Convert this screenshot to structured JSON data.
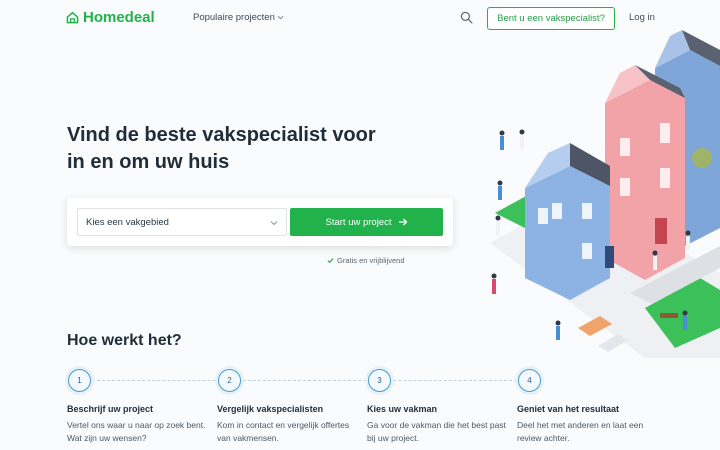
{
  "header": {
    "logo_text": "Homedeal",
    "nav_projects": "Populaire projecten",
    "pro_button": "Bent u een vakspecialist?",
    "login": "Log in"
  },
  "hero": {
    "headline": "Vind de beste vakspecialist voor in en om uw huis",
    "select_placeholder": "Kies een vakgebied",
    "start_button": "Start uw project",
    "free_note": "Gratis en vrijblijvend"
  },
  "how": {
    "title": "Hoe werkt het?",
    "steps": [
      {
        "num": "1",
        "title": "Beschrijf uw project",
        "text": "Vertel ons waar u naar op zoek bent. Wat zijn uw wensen?"
      },
      {
        "num": "2",
        "title": "Vergelijk vakspecialisten",
        "text": "Kom in contact en vergelijk offertes van vakmensen."
      },
      {
        "num": "3",
        "title": "Kies uw vakman",
        "text": "Ga voor de vakman die het best past bij uw project."
      },
      {
        "num": "4",
        "title": "Geniet van het resultaat",
        "text": "Deel het met anderen en laat een review achter."
      }
    ]
  },
  "colors": {
    "brand": "#22b24c",
    "step_accent": "#4a9bc8"
  },
  "icons": [
    "house-logo-icon",
    "chevron-down-icon",
    "search-icon",
    "arrow-right-icon",
    "check-icon"
  ]
}
